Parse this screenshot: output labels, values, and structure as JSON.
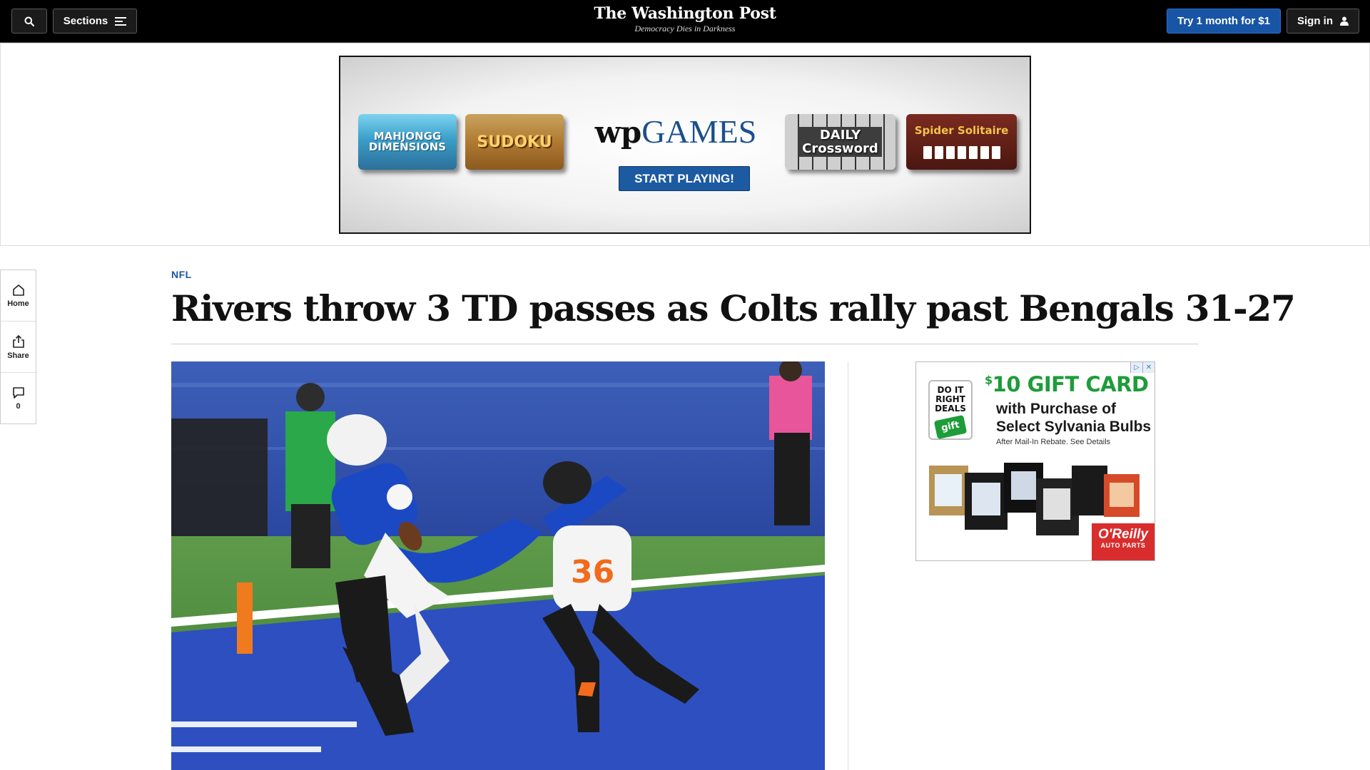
{
  "topbar": {
    "sections_label": "Sections",
    "try_label": "Try 1 month for $1",
    "signin_label": "Sign in",
    "logo_text": "The Washington Post",
    "tagline": "Democracy Dies in Darkness",
    "colors": {
      "background": "#000000",
      "subscribe_button": "#1955a5"
    },
    "icons": [
      "search-icon",
      "menu-icon",
      "user-icon"
    ]
  },
  "top_ad": {
    "tiles": {
      "mahjong": "MAHJONGG DIMENSIONS",
      "sudoku": "SUDOKU",
      "crossword_line1": "DAILY",
      "crossword_line2": "Crossword",
      "solitaire": "Spider Solitaire"
    },
    "brand_wp": "wp",
    "brand_games": "GAMES",
    "cta": "START PLAYING!"
  },
  "left_rail": {
    "home_label": "Home",
    "share_label": "Share",
    "comments_count": "0",
    "icons": [
      "home-icon",
      "share-icon",
      "comment-icon"
    ]
  },
  "article": {
    "kicker": "NFL",
    "headline": "Rivers throw 3 TD passes as Colts rally past Bengals 31-27",
    "kicker_color": "#1955a5"
  },
  "right_ad": {
    "badge_info": "▷",
    "badge_close": "✕",
    "logo_line1": "DO IT",
    "logo_line2": "RIGHT",
    "logo_line3": "DEALS",
    "logo_gift": "gift",
    "price_currency": "$",
    "price": "10 GIFT CARD",
    "line1": "with Purchase of",
    "line2": "Select Sylvania Bulbs",
    "fine_print": "After Mail-In Rebate. See Details",
    "brand_big": "O'Reilly",
    "brand_small": "AUTO PARTS",
    "colors": {
      "price": "#1e9c3a",
      "brand": "#d92d2d"
    }
  }
}
